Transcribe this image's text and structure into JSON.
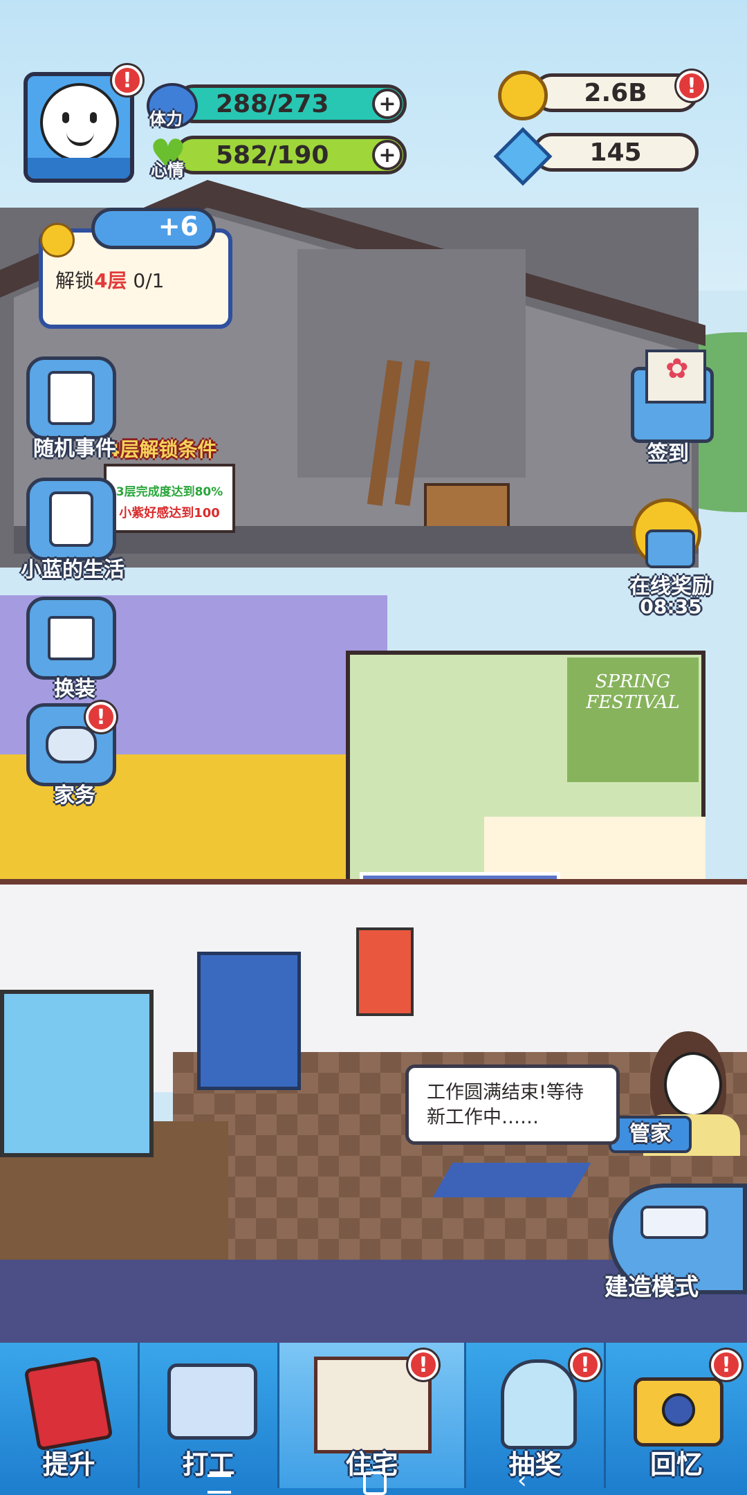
{
  "profile": {
    "avatar_icon": "smiley-face-avatar"
  },
  "stats": {
    "stamina_label": "体力",
    "stamina_value": "288/273",
    "mood_label": "心情",
    "mood_value": "582/190",
    "coins_value": "2.6B",
    "gems_value": "145"
  },
  "unlock_card": {
    "reward": "+6",
    "text_prefix": "解锁",
    "text_highlight": "4层",
    "progress": "0/1"
  },
  "side_left": [
    {
      "label": "随机事件",
      "icon": "notepad-icon"
    },
    {
      "label": "小蓝的生活",
      "icon": "washing-machine-icon"
    },
    {
      "label": "换装",
      "icon": "tshirt-icon"
    },
    {
      "label": "家务",
      "icon": "vacuum-icon"
    }
  ],
  "side_right": {
    "checkin_label": "签到",
    "online_reward_label": "在线奖励",
    "online_reward_time": "08:35",
    "build_mode_label": "建造模式",
    "butler_label": "管家"
  },
  "floor4_sign": {
    "title": "4层解锁条件",
    "cond1": "3层完成度达到80%",
    "cond2": "小紫好感达到100"
  },
  "poster_text": "SPRING FESTIVAL",
  "speech_bubble": "工作圆满结束!等待新工作中……",
  "bottom_nav": [
    {
      "label": "提升",
      "icon": "book-icon"
    },
    {
      "label": "打工",
      "icon": "tv-badge-icon"
    },
    {
      "label": "住宅",
      "icon": "house-room-icon"
    },
    {
      "label": "抽奖",
      "icon": "gacha-machine-icon"
    },
    {
      "label": "回忆",
      "icon": "camera-icon"
    }
  ],
  "colors": {
    "stamina_bar": "#27c7b4",
    "mood_bar": "#9fd63a",
    "alert": "#e23a3a",
    "nav_blue": "#2a8fdc"
  }
}
